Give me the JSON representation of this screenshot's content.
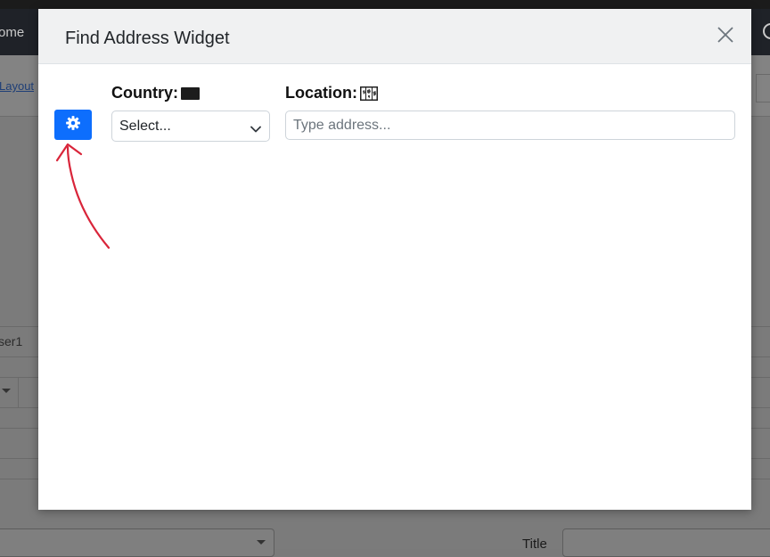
{
  "background": {
    "nav_home_label": "ome",
    "layout_link": "Layout",
    "user_cell": "ser1",
    "title_label": "Title"
  },
  "modal": {
    "title": "Find Address Widget",
    "close_icon": "close-icon",
    "settings_icon": "gear-icon",
    "country": {
      "label": "Country:",
      "flag_icon": "black-flag-icon",
      "selected_value": "Select..."
    },
    "location": {
      "label": "Location:",
      "map_icon": "world-map-icon",
      "placeholder": "Type address..."
    }
  },
  "annotation": {
    "arrow_color": "#d9253a",
    "target": "settings-button"
  },
  "colors": {
    "accent": "#0d6efd",
    "header_bg": "#f0f1f2"
  }
}
